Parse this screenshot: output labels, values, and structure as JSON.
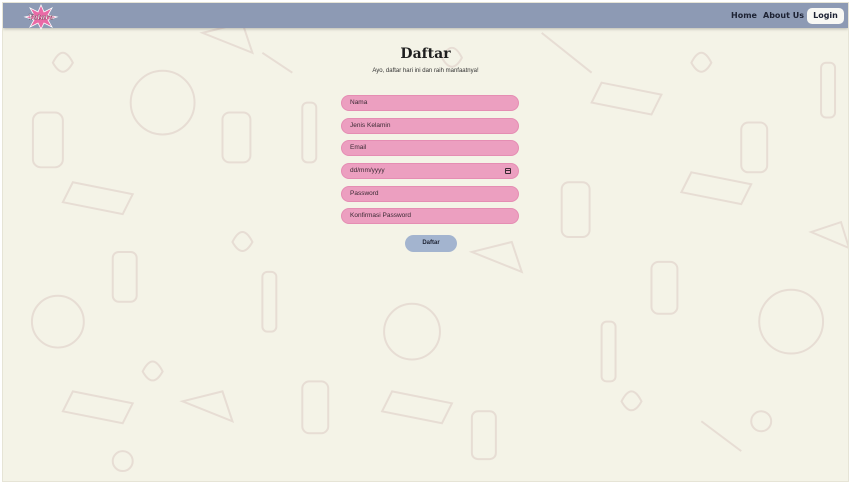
{
  "brand": {
    "logo_text": "Yatara",
    "logo_color": "#e96aa6"
  },
  "nav": {
    "home": "Home",
    "about": "About Us",
    "login": "Login",
    "bar_color": "#8d9ab4"
  },
  "form": {
    "title": "Daftar",
    "subtitle": "Ayo, daftar hari ini dan raih manfaatnya!",
    "fields": {
      "nama": "Nama",
      "jenis_kelamin": "Jenis Kelamin",
      "email": "Email",
      "tanggal": "dd/mm/yyyy",
      "password": "Password",
      "konfirmasi": "Konfirmasi Password"
    },
    "submit": "Daftar",
    "field_color": "#ec9fc0",
    "button_color": "#a3b4cf"
  },
  "icons": [
    "star-logo-icon",
    "calendar-icon"
  ]
}
